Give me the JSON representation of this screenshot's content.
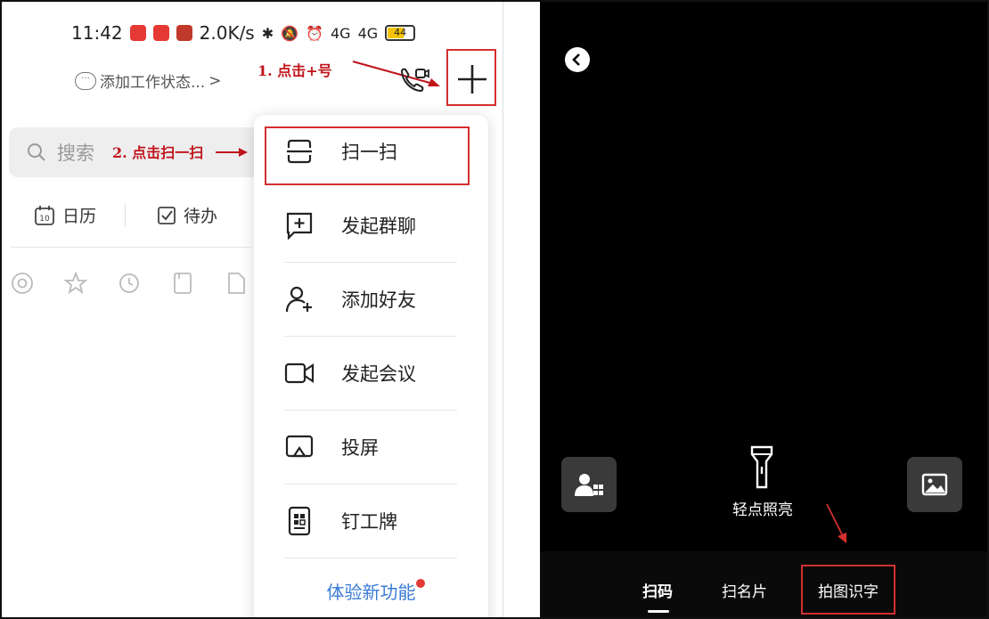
{
  "statusbar": {
    "time": "11:42",
    "speed": "2.0K/s",
    "net1": "4G",
    "net2": "4G",
    "battery": "44"
  },
  "left": {
    "status_prompt": "添加工作状态...",
    "status_arrow": ">",
    "annotation_1": "1. 点击+号",
    "annotation_2": "2. 点击扫一扫",
    "search_placeholder": "搜索",
    "quick": [
      {
        "label": "日历"
      },
      {
        "label": "待办"
      }
    ],
    "calendar_day": "10",
    "menu": [
      {
        "label": "扫一扫",
        "icon": "scan-icon"
      },
      {
        "label": "发起群聊",
        "icon": "group-chat-icon"
      },
      {
        "label": "添加好友",
        "icon": "add-friend-icon"
      },
      {
        "label": "发起会议",
        "icon": "video-meeting-icon"
      },
      {
        "label": "投屏",
        "icon": "cast-screen-icon"
      },
      {
        "label": "钉工牌",
        "icon": "badge-icon"
      }
    ],
    "menu_footer": "体验新功能"
  },
  "right": {
    "torch_label": "轻点照亮",
    "tabs": [
      "扫码",
      "扫名片",
      "拍图识字"
    ]
  },
  "colors": {
    "annotation": "#c0141c",
    "accent_link": "#3a7bd5",
    "camera_bg": "#000000"
  }
}
